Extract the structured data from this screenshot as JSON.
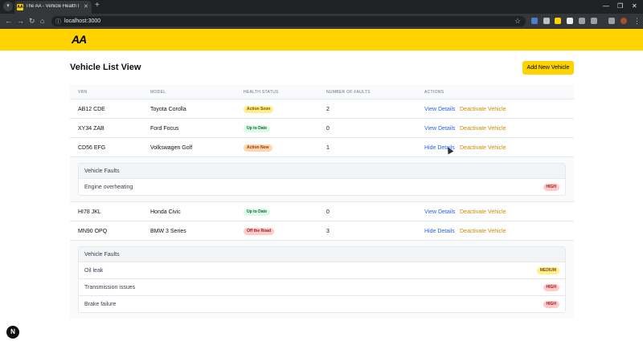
{
  "browser": {
    "tab_title": "The AA - Vehicle Health Monit",
    "url": "localhost:3000",
    "favicon_text": "AA"
  },
  "header": {
    "logo": "AA"
  },
  "page": {
    "title": "Vehicle List View",
    "add_button": "Add New Vehicle"
  },
  "table": {
    "columns": [
      "VRN",
      "MODEL",
      "HEALTH STATUS",
      "NUMBER OF FAULTS",
      "ACTIONS"
    ],
    "rows": [
      {
        "vrn": "AB12 CDE",
        "model": "Toyota Corolla",
        "status": "Action Soon",
        "faults": "2",
        "action": "View Details",
        "deactivate": "Deactivate Vehicle"
      },
      {
        "vrn": "XY34 ZAB",
        "model": "Ford Focus",
        "status": "Up to Date",
        "faults": "0",
        "action": "View Details",
        "deactivate": "Deactivate Vehicle"
      },
      {
        "vrn": "CD56 EFG",
        "model": "Volkswagen Golf",
        "status": "Action Now",
        "faults": "1",
        "action": "Hide Details",
        "deactivate": "Deactivate Vehicle"
      },
      {
        "vrn": "HI78 JKL",
        "model": "Honda Civic",
        "status": "Up to Date",
        "faults": "0",
        "action": "View Details",
        "deactivate": "Deactivate Vehicle"
      },
      {
        "vrn": "MN90 OPQ",
        "model": "BMW 3 Series",
        "status": "Off the Road",
        "faults": "3",
        "action": "Hide Details",
        "deactivate": "Deactivate Vehicle"
      }
    ]
  },
  "faults_panel_1": {
    "title": "Vehicle Faults",
    "items": [
      {
        "name": "Engine overheating",
        "severity": "HIGH"
      }
    ]
  },
  "faults_panel_2": {
    "title": "Vehicle Faults",
    "items": [
      {
        "name": "Oil leak",
        "severity": "MEDIUM"
      },
      {
        "name": "Transmission issues",
        "severity": "HIGH"
      },
      {
        "name": "Brake failure",
        "severity": "HIGH"
      }
    ]
  },
  "colors": {
    "brand": "#ffd300",
    "link": "#2563eb",
    "deactivate": "#ca8a04",
    "status_action_soon": "#fef08a",
    "status_up_to_date": "#dcfce7",
    "status_action_now": "#fed7aa",
    "status_off_road": "#fecaca"
  },
  "dev_badge": "N"
}
